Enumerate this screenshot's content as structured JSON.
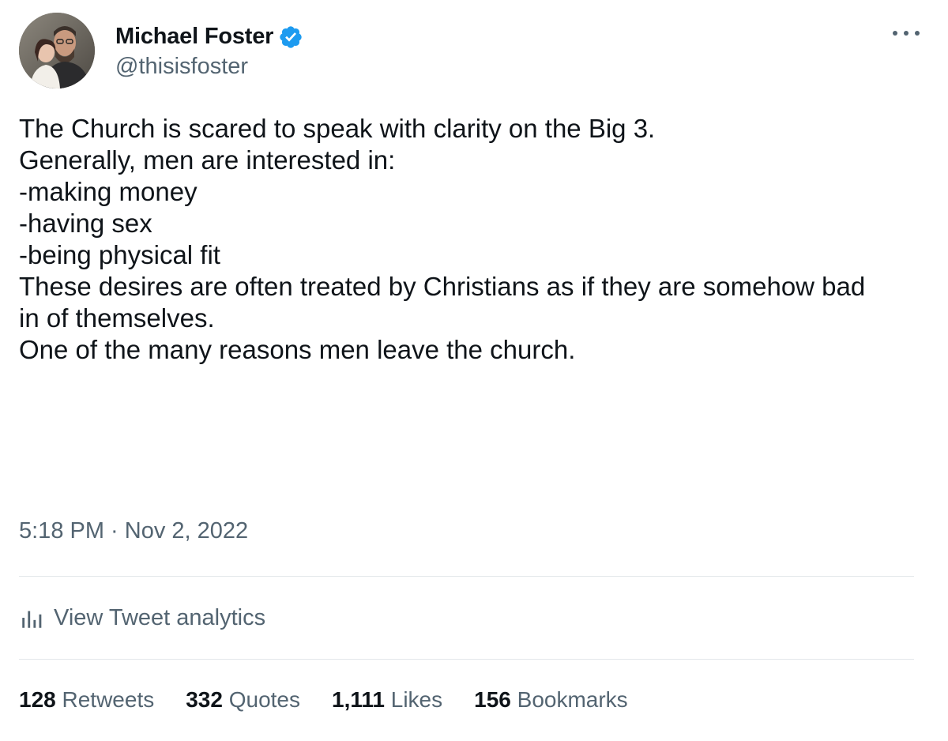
{
  "author": {
    "display_name": "Michael Foster",
    "handle": "@thisisfoster",
    "verified_icon": "verified-badge-icon",
    "avatar_icon": "profile-photo"
  },
  "more_icon": "more-horizontal-icon",
  "tweet": {
    "lines": [
      "The Church is scared to speak with clarity on the Big 3.",
      "",
      "Generally, men are interested in:",
      "",
      "-making money",
      "-having sex",
      "-being physical fit",
      "",
      "These desires are often treated by Christians as if they are somehow bad",
      "in of themselves.",
      "",
      "One of the many reasons men leave the church."
    ],
    "timestamp": "5:18 PM · Nov 2, 2022"
  },
  "analytics": {
    "icon": "analytics-bars-icon",
    "label": "View Tweet analytics"
  },
  "stats": [
    {
      "count": "128",
      "label": "Retweets"
    },
    {
      "count": "332",
      "label": "Quotes"
    },
    {
      "count": "1,111",
      "label": "Likes"
    },
    {
      "count": "156",
      "label": "Bookmarks"
    }
  ],
  "colors": {
    "text": "#0f1419",
    "secondary": "#536471",
    "verified": "#1d9bf0",
    "divider": "#e3e7ea"
  }
}
